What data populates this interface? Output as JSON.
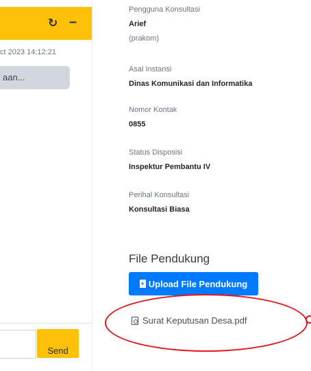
{
  "chat": {
    "refresh_icon": "refresh-icon",
    "minimize_icon": "minus-icon",
    "timestamp": "ct 2023 14:12:21",
    "message_preview": "aan...",
    "send_label": "Send",
    "header_color": "#ffc107"
  },
  "info": {
    "fields": [
      {
        "label": "Pengguna Konsultasi",
        "value": "Arief",
        "sub": "(prakom)"
      },
      {
        "label": "Asal Instansi",
        "value": "Dinas Komunikasi dan Informatika"
      },
      {
        "label": "Nomor Kontak",
        "value": "0855"
      },
      {
        "label": "Status Disposisi",
        "value": "Inspektur Pembantu IV"
      },
      {
        "label": "Perihal Konsultasi",
        "value": "Konsultasi Biasa"
      }
    ],
    "file_section_title": "File Pendukung",
    "upload_label": "Upload File Pendukung",
    "file_name": "Surat Keputusan Desa.pdf",
    "upload_color": "#007bff",
    "annotation_color": "#e3151a"
  }
}
